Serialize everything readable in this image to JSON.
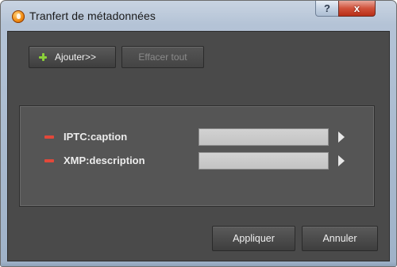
{
  "window": {
    "title": "Tranfert de métadonnées",
    "help_label": "?",
    "close_label": "x"
  },
  "toolbar": {
    "add_label": "Ajouter>>",
    "clear_label": "Effacer tout"
  },
  "fields": [
    {
      "label": "IPTC:caption",
      "value": ""
    },
    {
      "label": "XMP:description",
      "value": ""
    }
  ],
  "footer": {
    "apply_label": "Appliquer",
    "cancel_label": "Annuler"
  },
  "icons": {
    "app": "app-icon",
    "add": "plus-icon",
    "remove": "minus-icon",
    "expand": "arrow-right-icon"
  },
  "colors": {
    "add_icon": "#8bd03a",
    "remove_icon": "#e2483a",
    "close_button": "#c8412a",
    "dialog_body": "#4a4a4a"
  }
}
